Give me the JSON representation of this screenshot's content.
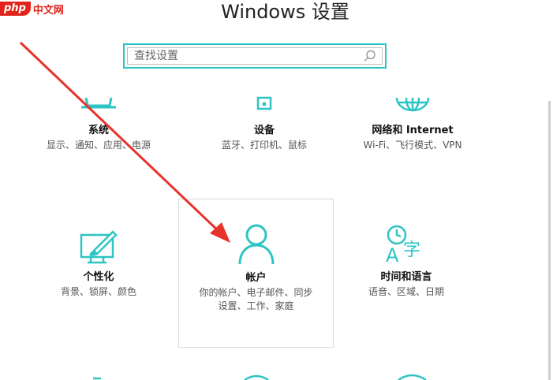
{
  "watermark": {
    "logo": "php",
    "text": "中文网"
  },
  "window": {
    "title": "Windows 设置"
  },
  "search": {
    "placeholder": "查找设置"
  },
  "tiles": [
    {
      "id": "system",
      "title": "系统",
      "desc": "显示、通知、应用、电源",
      "icon": "laptop-icon"
    },
    {
      "id": "devices",
      "title": "设备",
      "desc": "蓝牙、打印机、鼠标",
      "icon": "keyboard-speaker-icon"
    },
    {
      "id": "network",
      "title": "网络和 Internet",
      "desc": "Wi-Fi、飞行模式、VPN",
      "icon": "globe-icon"
    },
    {
      "id": "personalization",
      "title": "个性化",
      "desc": "背景、锁屏、颜色",
      "icon": "paint-brush-icon"
    },
    {
      "id": "accounts",
      "title": "帐户",
      "desc_line1": "你的帐户、电子邮件、同步",
      "desc_line2": "设置、工作、家庭",
      "icon": "person-icon"
    },
    {
      "id": "time-language",
      "title": "时间和语言",
      "desc": "语音、区域、日期",
      "icon": "clock-language-icon"
    }
  ],
  "colors": {
    "accent": "#2ec4c4",
    "arrow": "#e8332b",
    "watermark": "#e2231a"
  }
}
